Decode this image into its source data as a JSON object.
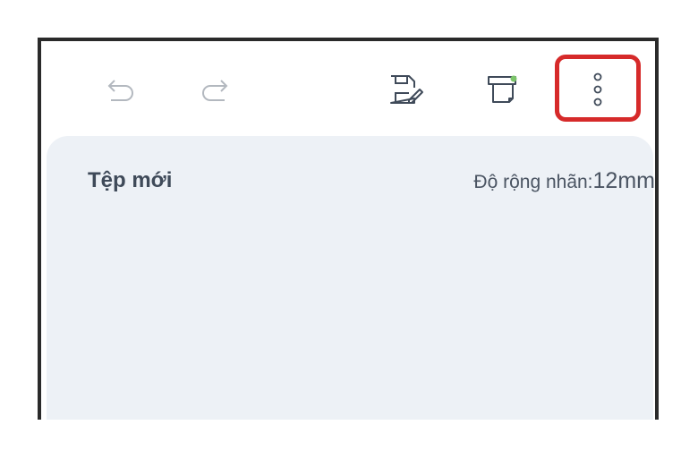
{
  "toolbar": {
    "icons": [
      "undo-icon",
      "redo-icon",
      "save-edit-icon",
      "print-label-icon",
      "more-vertical-icon"
    ],
    "accent_highlight": "#d62a2a",
    "print_status_dot": "#7cc46a"
  },
  "document": {
    "title": "Tệp mới",
    "label_width_caption": "Độ rộng nhãn:",
    "label_width_value": "12mm"
  },
  "colors": {
    "panel_bg": "#edf1f6",
    "text_dark": "#3f4a59",
    "icon_gray": "#a9aeb6"
  }
}
